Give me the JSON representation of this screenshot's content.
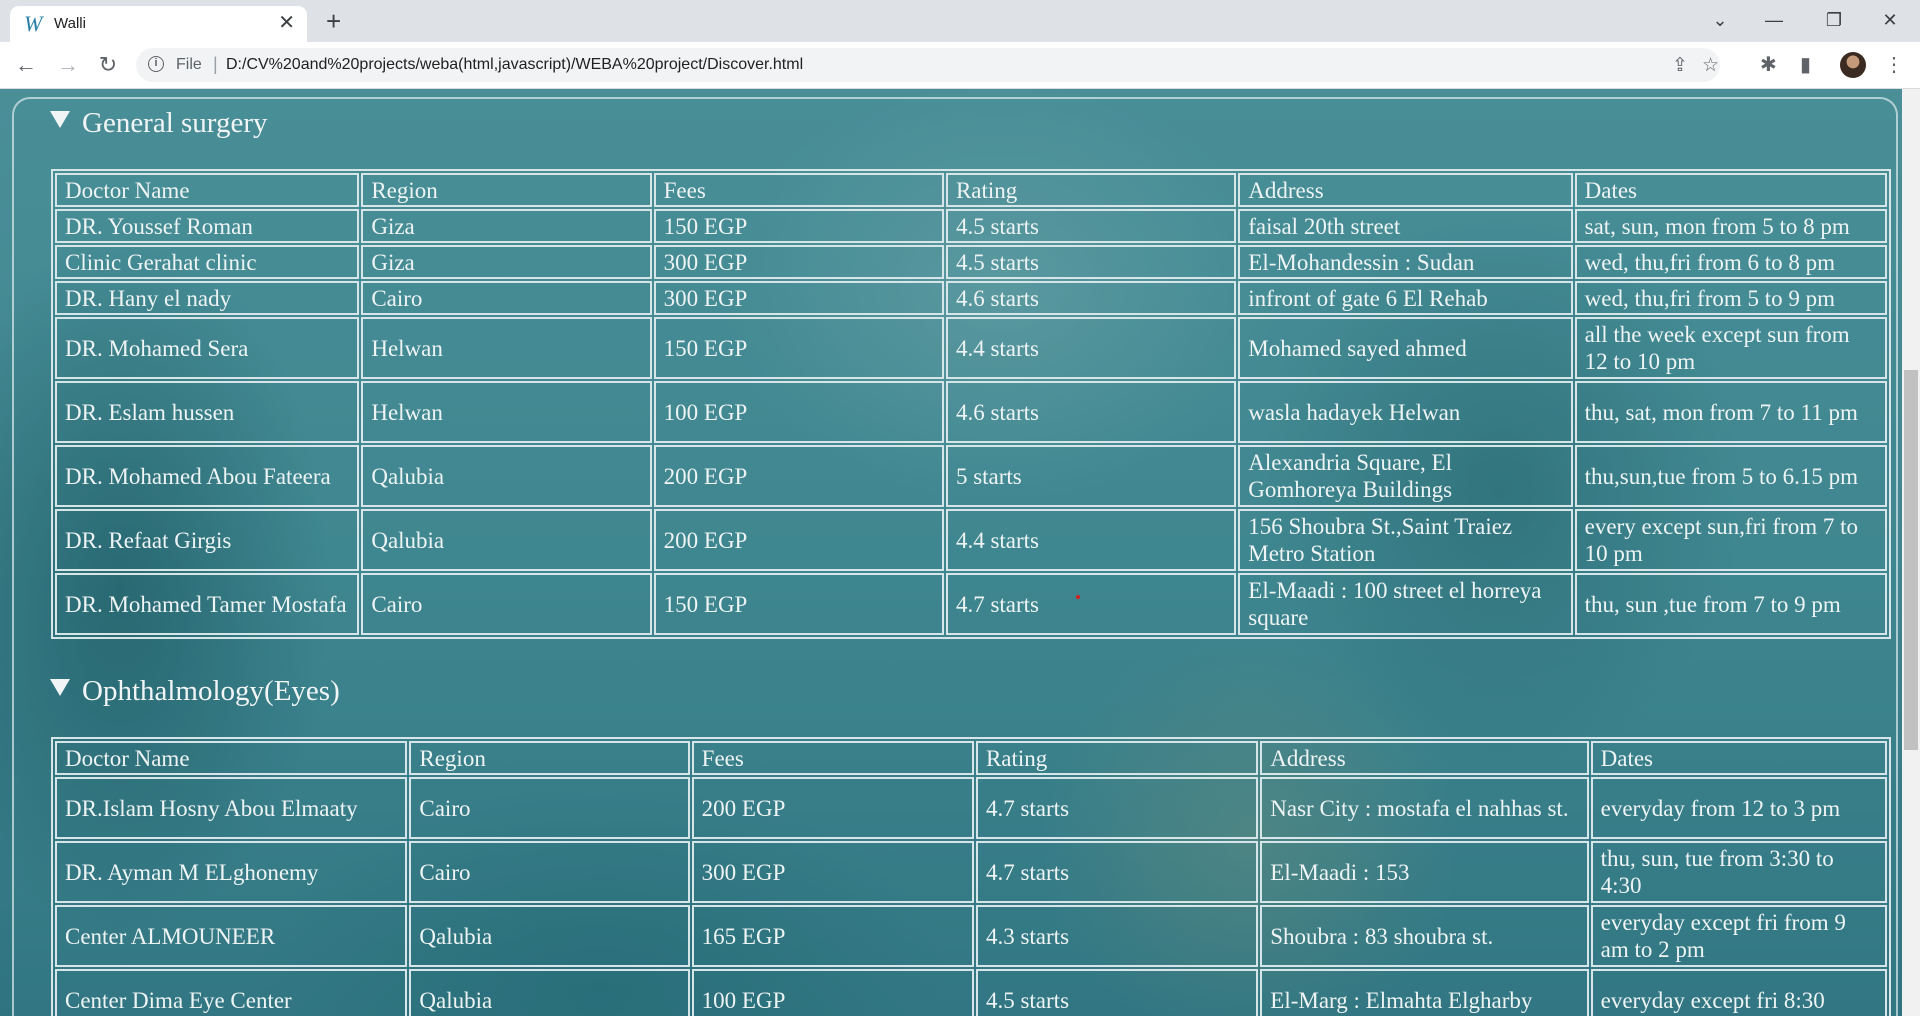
{
  "browser": {
    "tab_title": "Walli",
    "tab_favicon": "W",
    "file_label": "File",
    "url": "D:/CV%20and%20projects/weba(html,javascript)/WEBA%20project/Discover.html"
  },
  "sections": [
    {
      "title": "General surgery",
      "headers": [
        "Doctor Name",
        "Region",
        "Fees",
        "Rating",
        "Address",
        "Dates"
      ],
      "rows": [
        [
          "DR. Youssef Roman",
          "Giza",
          "150 EGP",
          "4.5 starts",
          "faisal 20th street",
          "sat, sun, mon from 5 to 8 pm"
        ],
        [
          "Clinic Gerahat clinic",
          "Giza",
          "300 EGP",
          "4.5 starts",
          "El-Mohandessin : Sudan",
          "wed, thu,fri from 6 to 8 pm"
        ],
        [
          "DR. Hany el nady",
          "Cairo",
          "300 EGP",
          "4.6 starts",
          "infront of gate 6 El Rehab",
          "wed, thu,fri from 5 to 9 pm"
        ],
        [
          "DR. Mohamed Sera",
          "Helwan",
          "150 EGP",
          "4.4 starts",
          "Mohamed sayed ahmed",
          "all the week except sun from 12 to 10 pm"
        ],
        [
          "DR. Eslam hussen",
          "Helwan",
          "100 EGP",
          "4.6 starts",
          "wasla hadayek Helwan",
          "thu, sat, mon from 7 to 11 pm"
        ],
        [
          "DR. Mohamed Abou Fateera",
          "Qalubia",
          "200 EGP",
          "5 starts",
          "Alexandria Square, El Gomhoreya Buildings",
          "thu,sun,tue from 5 to 6.15 pm"
        ],
        [
          "DR. Refaat Girgis",
          "Qalubia",
          "200 EGP",
          "4.4 starts",
          "156 Shoubra St.,Saint Traiez Metro Station",
          "every except sun,fri from 7 to 10 pm"
        ],
        [
          "DR. Mohamed Tamer Mostafa",
          "Cairo",
          "150 EGP",
          "4.7 starts",
          "El-Maadi : 100 street el horreya square",
          "thu, sun ,tue from 7 to 9 pm"
        ]
      ]
    },
    {
      "title": "Ophthalmology(Eyes)",
      "headers": [
        "Doctor Name",
        "Region",
        "Fees",
        "Rating",
        "Address",
        "Dates"
      ],
      "rows": [
        [
          "DR.Islam Hosny Abou Elmaaty",
          "Cairo",
          "200 EGP",
          "4.7 starts",
          "Nasr City : mostafa el nahhas st.",
          "everyday from 12 to 3 pm"
        ],
        [
          "DR. Ayman M ELghonemy",
          "Cairo",
          "300 EGP",
          "4.7 starts",
          "El-Maadi : 153",
          "thu, sun, tue from 3:30 to 4:30"
        ],
        [
          "Center ALMOUNEER",
          "Qalubia",
          "165 EGP",
          "4.3 starts",
          "Shoubra : 83 shoubra st.",
          "everyday except fri from 9 am to 2 pm"
        ],
        [
          "Center Dima Eye Center",
          "Qalubia",
          "100 EGP",
          "4.5 starts",
          "El-Marg : Elmahta Elgharby",
          "everyday except fri 8:30"
        ]
      ]
    }
  ]
}
